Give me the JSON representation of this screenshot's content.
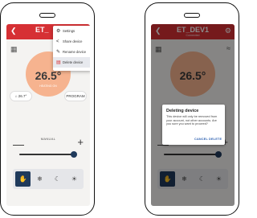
{
  "left_phone": {
    "device_name": "ET_",
    "back_icon": "chevron-left-icon",
    "temperature": "26.5°",
    "status_label": "HEATING ON",
    "floor_temp": "26.7°",
    "program_label": "PROGRAM",
    "mode_label": "MANUAL",
    "setpoint_level": 0.95,
    "menu": [
      {
        "icon": "gear-icon",
        "label": "Settings"
      },
      {
        "icon": "share-icon",
        "label": "Share device"
      },
      {
        "icon": "edit-icon",
        "label": "Rename device"
      },
      {
        "icon": "trash-icon",
        "label": "Delete device",
        "selected": true
      }
    ],
    "modes": [
      {
        "icon": "hand-icon",
        "active": true
      },
      {
        "icon": "snowflake-icon"
      },
      {
        "icon": "moon-icon"
      },
      {
        "icon": "sun-icon"
      }
    ]
  },
  "right_phone": {
    "device_name": "ET_DEV1",
    "device_subtitle": "Connected",
    "temperature": "26.5°",
    "mode_label": "MANUAL",
    "dialog": {
      "title": "Deleting device",
      "message": "This device will only be removed from your account, not other accounts. Are you sure you want to proceed?",
      "cancel_label": "CANCEL",
      "delete_label": "DELETE"
    }
  },
  "colors": {
    "header_red": "#d63034",
    "temp_circle": "#f6b38f",
    "active_mode": "#1f3a5b",
    "dialog_button": "#2b5fb0"
  }
}
